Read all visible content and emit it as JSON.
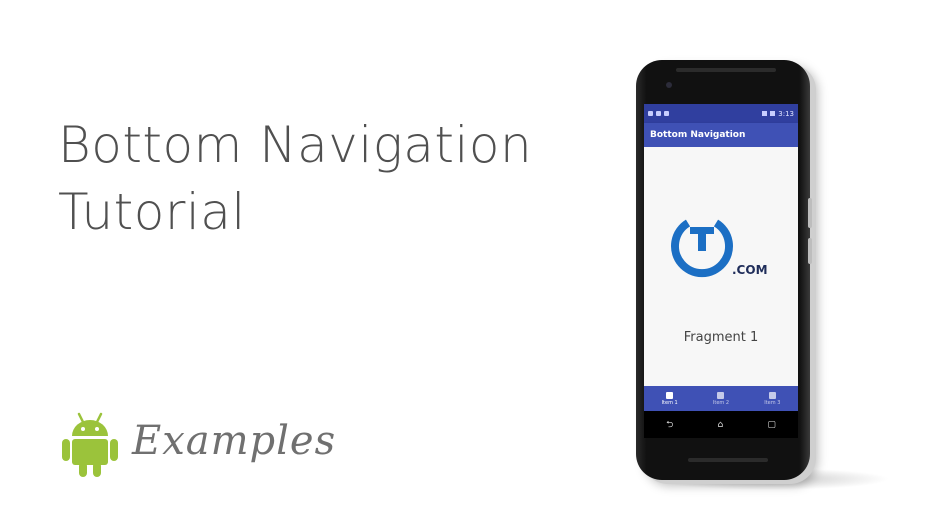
{
  "headline": {
    "line1": "Bottom Navigation",
    "line2": "Tutorial"
  },
  "brand": {
    "examples_text": "Examples"
  },
  "phone": {
    "status_time": "3:13",
    "app_title": "Bottom Navigation",
    "logo_suffix": ".COM",
    "fragment_label": "Fragment 1",
    "bottom_nav": [
      {
        "label": "Item 1",
        "active": true
      },
      {
        "label": "Item 2",
        "active": false
      },
      {
        "label": "Item 3",
        "active": false
      }
    ],
    "system_nav": {
      "back": "⮌",
      "home": "⌂",
      "recents": "▢"
    }
  },
  "colors": {
    "primary": "#3f51b5",
    "primary_dark": "#303f9f",
    "android_green": "#9bc33b",
    "logo_blue": "#1c6fc4"
  },
  "icons": [
    "android-icon",
    "logo-icon",
    "nav-item-icon"
  ]
}
